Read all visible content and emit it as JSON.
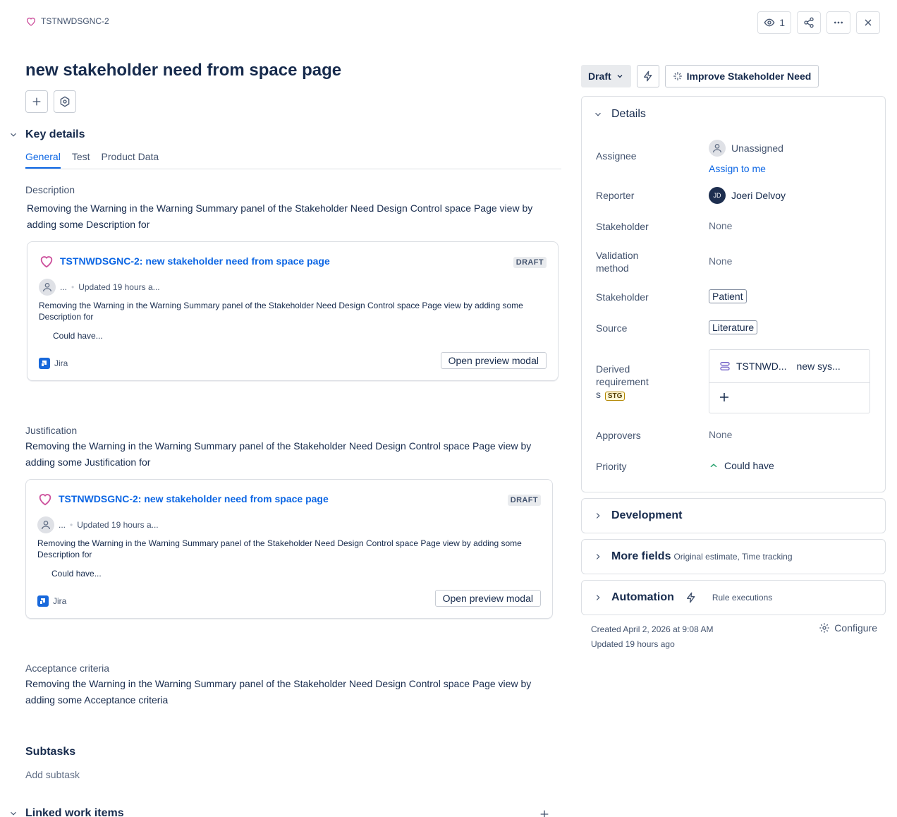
{
  "header": {
    "issue_key": "TSTNWDSGNC-2",
    "watch_count": "1"
  },
  "title": "new stakeholder need from space page",
  "key_details": {
    "heading": "Key details",
    "tabs": [
      {
        "label": "General"
      },
      {
        "label": "Test"
      },
      {
        "label": "Product Data"
      }
    ]
  },
  "description": {
    "label": "Description",
    "text": "Removing the Warning in the Warning Summary panel of the Stakeholder Need Design Control space Page view by adding some Description for"
  },
  "card1": {
    "link": "TSTNWDSGNC-2: new stakeholder need from space page",
    "badge": "DRAFT",
    "user": "...",
    "updated": "Updated 19 hours a...",
    "desc": "Removing the Warning in the Warning Summary panel of the Stakeholder Need Design Control space Page view by adding some Description for",
    "more": "Could have...",
    "source": "Jira",
    "button": "Open preview modal"
  },
  "justification": {
    "label": "Justification",
    "text": "Removing the Warning in the Warning Summary panel of the Stakeholder Need Design Control space Page view by adding some Justification for"
  },
  "card2": {
    "link": "TSTNWDSGNC-2: new stakeholder need from space page",
    "badge": "DRAFT",
    "user": "...",
    "updated": "Updated 19 hours a...",
    "desc": "Removing the Warning in the Warning Summary panel of the Stakeholder Need Design Control space Page view by adding some Description for",
    "more": "Could have...",
    "source": "Jira",
    "button": "Open preview modal"
  },
  "acceptance": {
    "label": "Acceptance criteria",
    "text": "Removing the Warning in the Warning Summary panel of the Stakeholder Need Design Control space Page view by adding some Acceptance criteria"
  },
  "subtasks": {
    "heading": "Subtasks",
    "add": "Add subtask"
  },
  "linked": {
    "heading": "Linked work items"
  },
  "status": {
    "label": "Draft",
    "improve": "Improve Stakeholder Need"
  },
  "details": {
    "heading": "Details",
    "assignee_label": "Assignee",
    "assignee_value": "Unassigned",
    "assign_to_me": "Assign to me",
    "reporter_label": "Reporter",
    "reporter_initials": "JD",
    "reporter_value": "Joeri Delvoy",
    "stakeholder_label": "Stakeholder",
    "stakeholder_value": "None",
    "validation_label": "Validation method",
    "validation_value": "None",
    "stakeholder2_label": "Stakeholder",
    "stakeholder2_value": "Patient",
    "source_label": "Source",
    "source_value": "Literature",
    "derived_label_1": "Derived",
    "derived_label_2": "requirement",
    "derived_label_3": "s",
    "derived_badge": "STG",
    "derived_key": "TSTNWD...",
    "derived_summary": "new sys...",
    "approvers_label": "Approvers",
    "approvers_value": "None",
    "priority_label": "Priority",
    "priority_value": "Could have"
  },
  "development": {
    "heading": "Development"
  },
  "more_fields": {
    "heading": "More fields",
    "sub": "Original estimate, Time tracking"
  },
  "automation": {
    "heading": "Automation",
    "sub": "Rule executions"
  },
  "footer": {
    "created": "Created April 2, 2026 at 9:08 AM",
    "updated": "Updated 19 hours ago",
    "configure": "Configure"
  },
  "colors": {
    "link": "#0c66e4",
    "heart": "#cd519d",
    "text": "#172b4d",
    "subtle": "#44546f"
  }
}
